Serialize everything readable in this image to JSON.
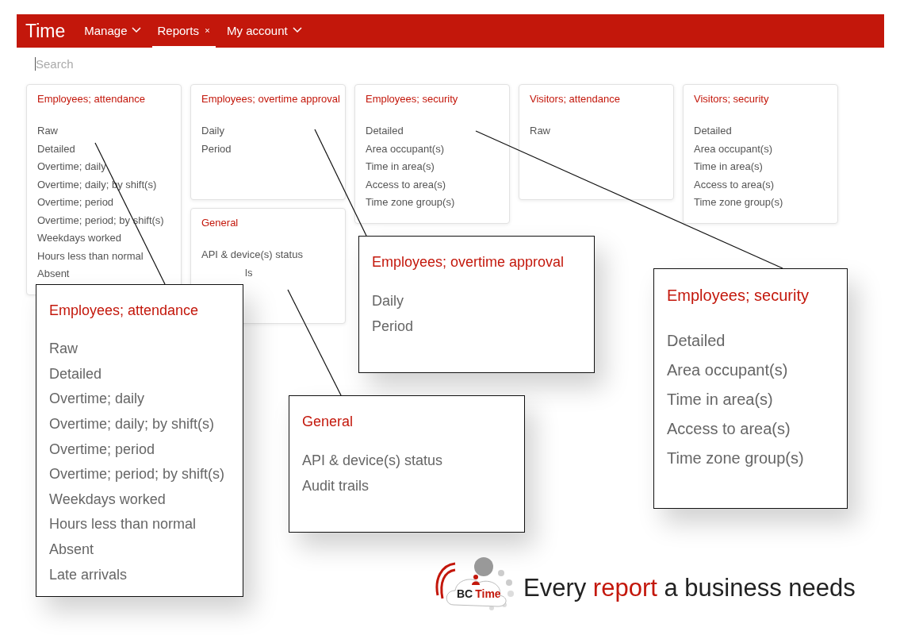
{
  "app": {
    "title": "Time",
    "nav": [
      {
        "label": "Manage",
        "selected": false,
        "kind": "dropdown"
      },
      {
        "label": "Reports",
        "selected": true,
        "kind": "closable"
      },
      {
        "label": "My account",
        "selected": false,
        "kind": "dropdown"
      }
    ]
  },
  "search": {
    "placeholder": "Search"
  },
  "columns": [
    {
      "cards": [
        {
          "title": "Employees; attendance",
          "items": [
            {
              "label": "Raw"
            },
            {
              "label": "Detailed"
            },
            {
              "label": "Overtime; daily"
            },
            {
              "label": "Overtime; daily; by shift(s)"
            },
            {
              "label": "Overtime; period"
            },
            {
              "label": "Overtime; period; by shift(s)"
            },
            {
              "label": "Weekdays worked"
            },
            {
              "label": "Hours less than normal"
            },
            {
              "label": "Absent"
            }
          ]
        }
      ]
    },
    {
      "cards": [
        {
          "title": "Employees; overtime approval",
          "items": [
            {
              "label": "Daily"
            },
            {
              "label": "Period"
            }
          ]
        },
        {
          "title": "General",
          "items": [
            {
              "label": "API & device(s) status"
            },
            {
              "label": "ls",
              "kind": "partial"
            }
          ]
        }
      ]
    },
    {
      "cards": [
        {
          "title": "Employees; security",
          "items": [
            {
              "label": "Detailed"
            },
            {
              "label": "Area occupant(s)"
            },
            {
              "label": "Time in area(s)"
            },
            {
              "label": "Access to area(s)"
            },
            {
              "label": "Time zone group(s)"
            }
          ]
        }
      ]
    },
    {
      "cards": [
        {
          "title": "Visitors; attendance",
          "items": [
            {
              "label": "Raw"
            }
          ]
        }
      ]
    },
    {
      "cards": [
        {
          "title": "Visitors; security",
          "items": [
            {
              "label": "Detailed"
            },
            {
              "label": "Area occupant(s)"
            },
            {
              "label": "Time in area(s)"
            },
            {
              "label": "Access to area(s)"
            },
            {
              "label": "Time zone group(s)"
            }
          ]
        }
      ]
    }
  ],
  "callouts": [
    {
      "title": "Employees; attendance",
      "items": [
        "Raw",
        "Detailed",
        "Overtime; daily",
        "Overtime; daily; by shift(s)",
        "Overtime; period",
        "Overtime; period; by shift(s)",
        "Weekdays worked",
        "Hours less than normal",
        "Absent",
        "Late arrivals"
      ]
    },
    {
      "title": "Employees; overtime approval",
      "items": [
        "Daily",
        "Period"
      ]
    },
    {
      "title": "General",
      "items": [
        "API & device(s) status",
        "Audit trails"
      ]
    },
    {
      "title": "Employees; security",
      "items": [
        "Detailed",
        "Area occupant(s)",
        "Time in area(s)",
        "Access to area(s)",
        "Time zone group(s)"
      ]
    }
  ],
  "logo": {
    "first": "BC",
    "second": "Time"
  },
  "tagline": "Every **report** a business needs"
}
